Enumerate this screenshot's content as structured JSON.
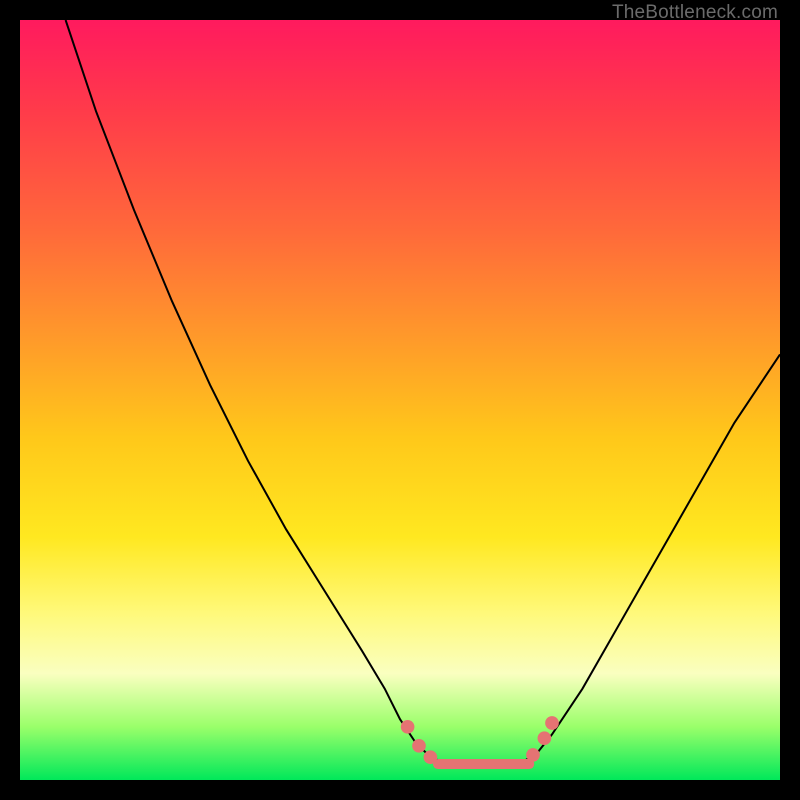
{
  "credit": "TheBottleneck.com",
  "chart_data": {
    "type": "line",
    "title": "",
    "xlabel": "",
    "ylabel": "",
    "xlim": [
      0,
      100
    ],
    "ylim": [
      0,
      100
    ],
    "series": [
      {
        "name": "left-branch",
        "x": [
          6,
          10,
          15,
          20,
          25,
          30,
          35,
          40,
          45,
          48,
          50,
          52,
          54,
          56
        ],
        "values": [
          100,
          88,
          75,
          63,
          52,
          42,
          33,
          25,
          17,
          12,
          8,
          5,
          3,
          2.2
        ]
      },
      {
        "name": "floor",
        "x": [
          56,
          58,
          60,
          62,
          64,
          66
        ],
        "values": [
          2.2,
          2.0,
          2.0,
          2.0,
          2.1,
          2.3
        ]
      },
      {
        "name": "right-branch",
        "x": [
          66,
          68,
          70,
          74,
          78,
          82,
          86,
          90,
          94,
          98,
          100
        ],
        "values": [
          2.3,
          3.5,
          6,
          12,
          19,
          26,
          33,
          40,
          47,
          53,
          56
        ]
      }
    ],
    "markers": [
      {
        "x": 51.0,
        "y": 7.0
      },
      {
        "x": 52.5,
        "y": 4.5
      },
      {
        "x": 54.0,
        "y": 3.0
      },
      {
        "x": 67.5,
        "y": 3.3
      },
      {
        "x": 69.0,
        "y": 5.5
      },
      {
        "x": 70.0,
        "y": 7.5
      }
    ],
    "floor_segment": {
      "x1": 55,
      "x2": 67,
      "y": 2.1
    },
    "gradient_stops": [
      {
        "pct": 0,
        "color": "#ff1a5e"
      },
      {
        "pct": 50,
        "color": "#ffc81a"
      },
      {
        "pct": 85,
        "color": "#faffc0"
      },
      {
        "pct": 100,
        "color": "#00e85a"
      }
    ]
  }
}
